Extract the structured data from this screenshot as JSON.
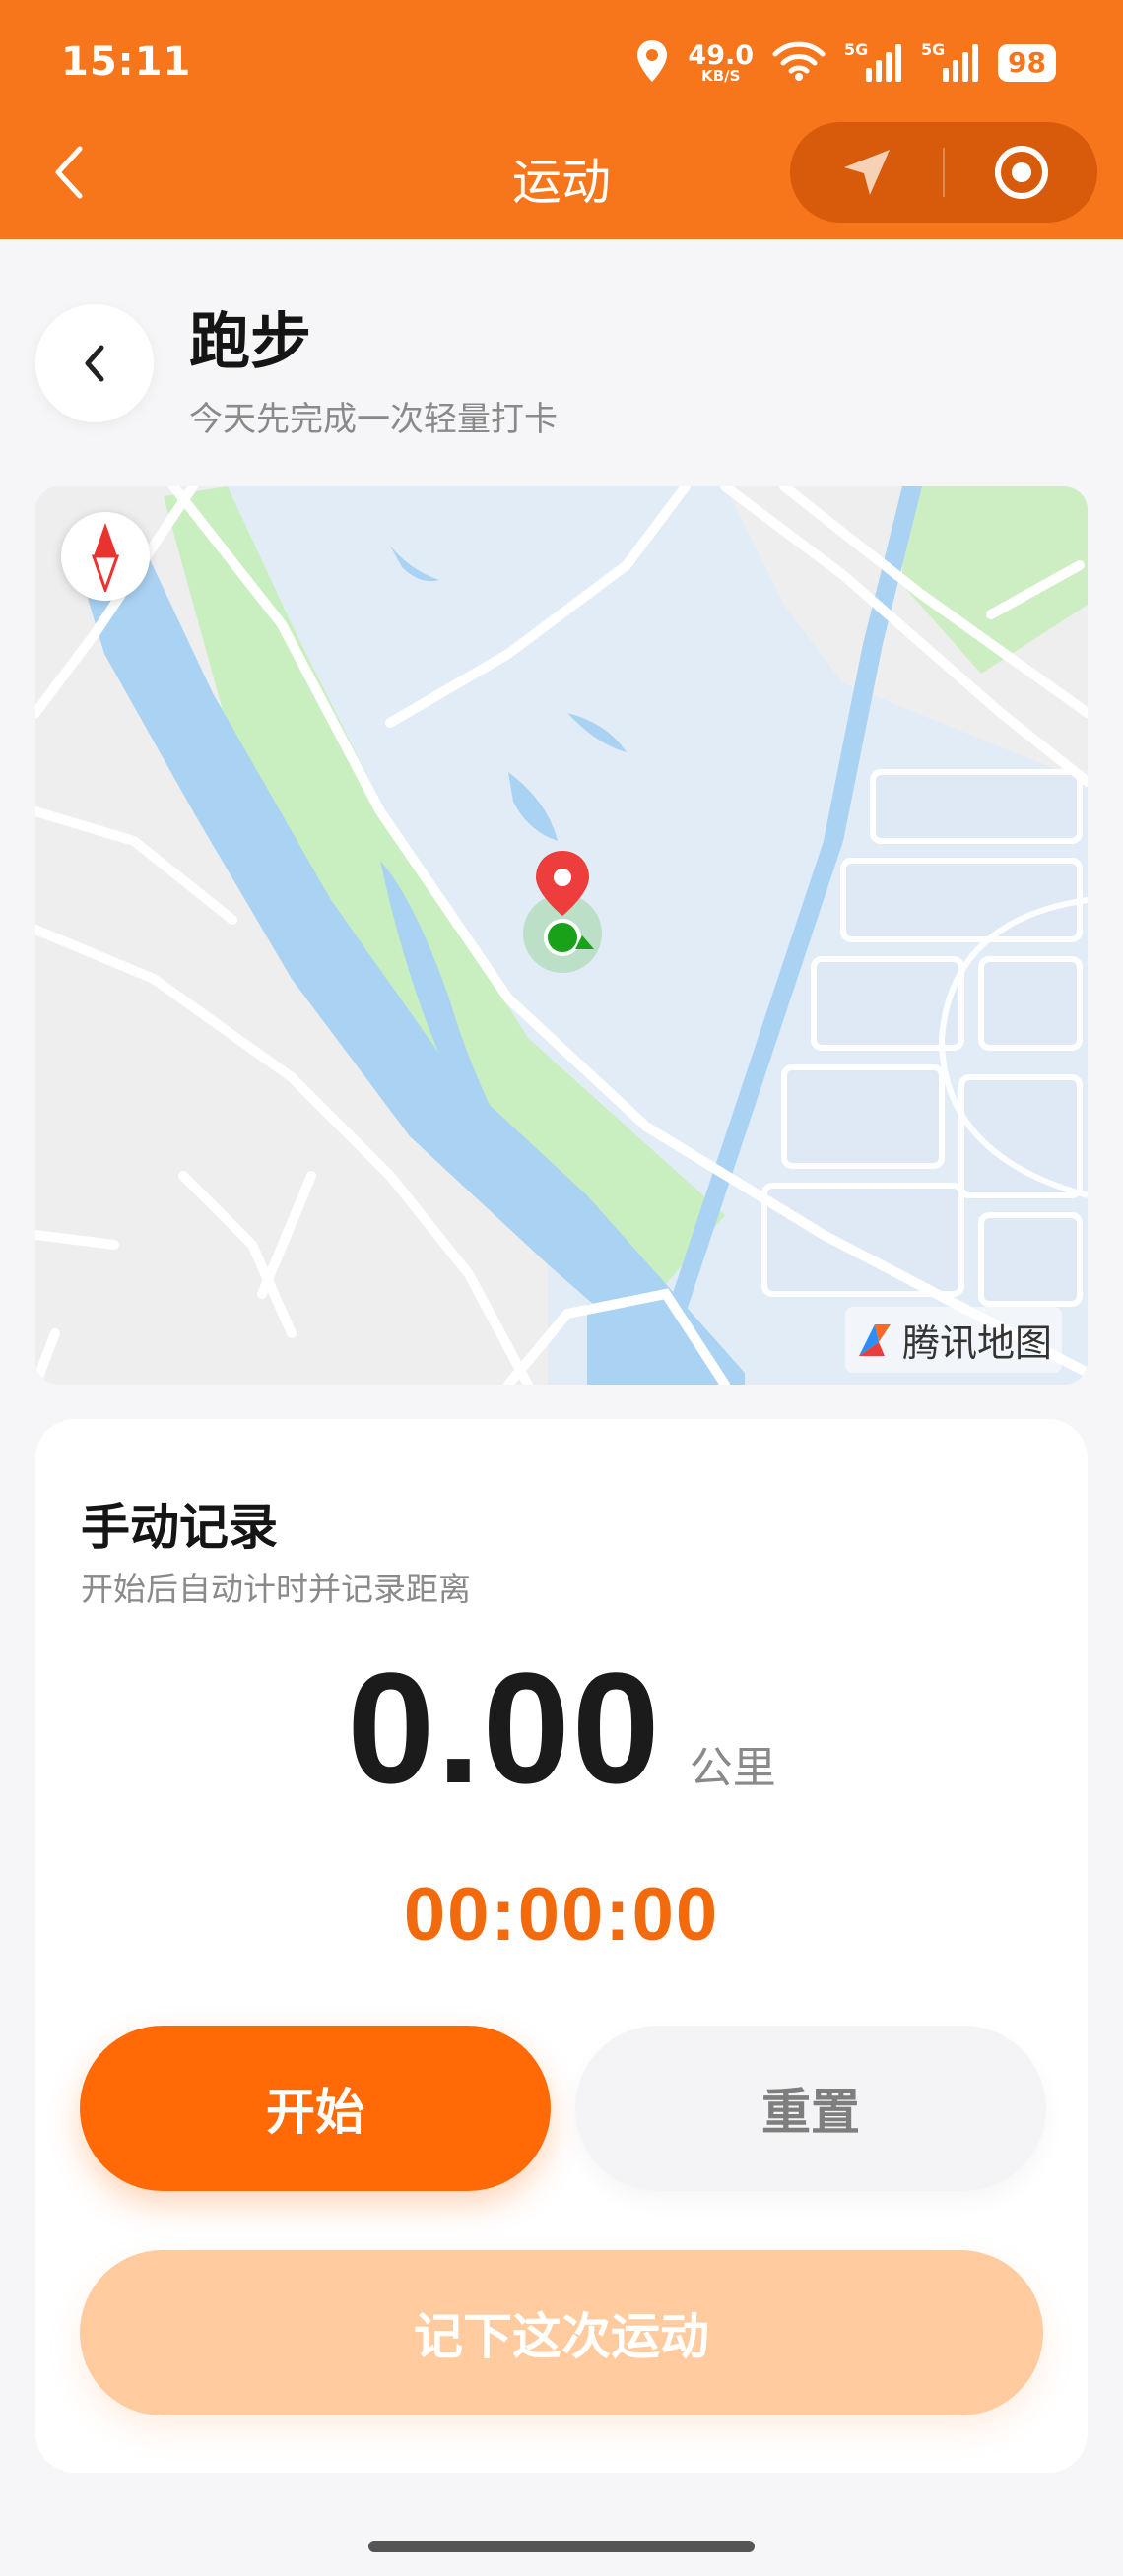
{
  "status_bar": {
    "time": "15:11",
    "net_speed_value": "49.0",
    "net_speed_unit": "KB/S",
    "sim1_label": "5G",
    "sim2_label": "5G",
    "battery": "98",
    "icons": [
      "location-icon",
      "wifi-icon",
      "signal-icon",
      "signal-icon",
      "battery-icon"
    ]
  },
  "nav": {
    "title": "运动",
    "back_icon": "chevron-left-icon",
    "capsule_icons": [
      "navigation-arrow-icon",
      "record-target-icon"
    ]
  },
  "header": {
    "title": "跑步",
    "subtitle": "今天先完成一次轻量打卡",
    "back_icon": "chevron-left-icon"
  },
  "map": {
    "provider_label": "腾讯地图",
    "compass_icon": "compass-icon",
    "marker_icon": "map-pin-icon"
  },
  "record": {
    "title": "手动记录",
    "subtitle": "开始后自动计时并记录距离",
    "distance": "0.00",
    "distance_unit": "公里",
    "timer": "00:00:00",
    "start_label": "开始",
    "reset_label": "重置",
    "save_label": "记下这次运动"
  },
  "colors": {
    "brand_orange": "#f8761b",
    "primary_button": "#ff6a06",
    "timer": "#f36a0c",
    "disabled_button": "#ffcb9f"
  }
}
